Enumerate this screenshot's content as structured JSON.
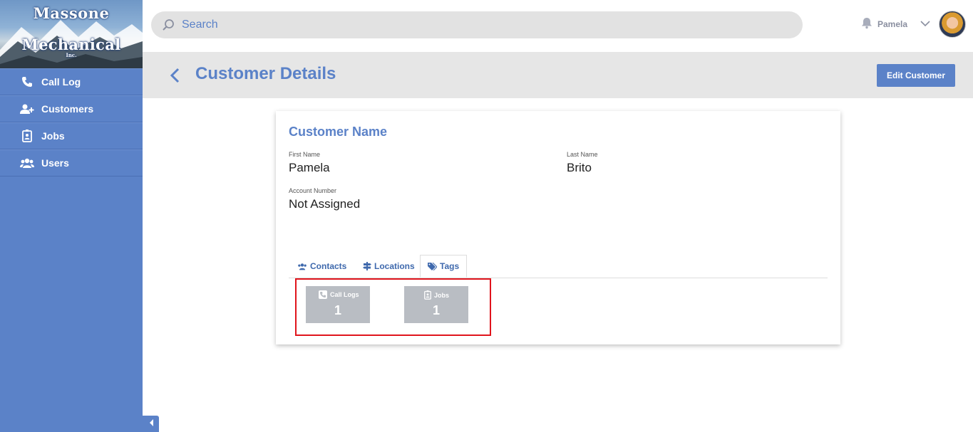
{
  "brand": {
    "line1": "Massone",
    "line2": "Mechanical",
    "line3": "Inc."
  },
  "sidebar": {
    "items": [
      {
        "label": "Call Log",
        "icon": "phone-icon"
      },
      {
        "label": "Customers",
        "icon": "user-plus-icon"
      },
      {
        "label": "Jobs",
        "icon": "badge-icon"
      },
      {
        "label": "Users",
        "icon": "users-icon"
      }
    ]
  },
  "search": {
    "placeholder": "Search"
  },
  "user": {
    "name": "Pamela"
  },
  "header": {
    "title": "Customer Details",
    "edit_label": "Edit Customer"
  },
  "customer": {
    "section_title": "Customer Name",
    "first_name_label": "First Name",
    "first_name": "Pamela",
    "last_name_label": "Last Name",
    "last_name": "Brito",
    "account_label": "Account Number",
    "account": "Not Assigned"
  },
  "tabs": [
    {
      "label": "Contacts",
      "icon": "users-icon"
    },
    {
      "label": "Locations",
      "icon": "signpost-icon"
    },
    {
      "label": "Tags",
      "icon": "tags-icon",
      "active": true
    }
  ],
  "tiles": [
    {
      "label": "Call Logs",
      "count": "1",
      "icon": "phone-icon"
    },
    {
      "label": "Jobs",
      "count": "1",
      "icon": "badge-icon"
    }
  ],
  "colors": {
    "accent": "#5b82c8",
    "sidebar": "#5b82c8",
    "tile": "#b9bdc3",
    "highlight": "#e0141c"
  }
}
